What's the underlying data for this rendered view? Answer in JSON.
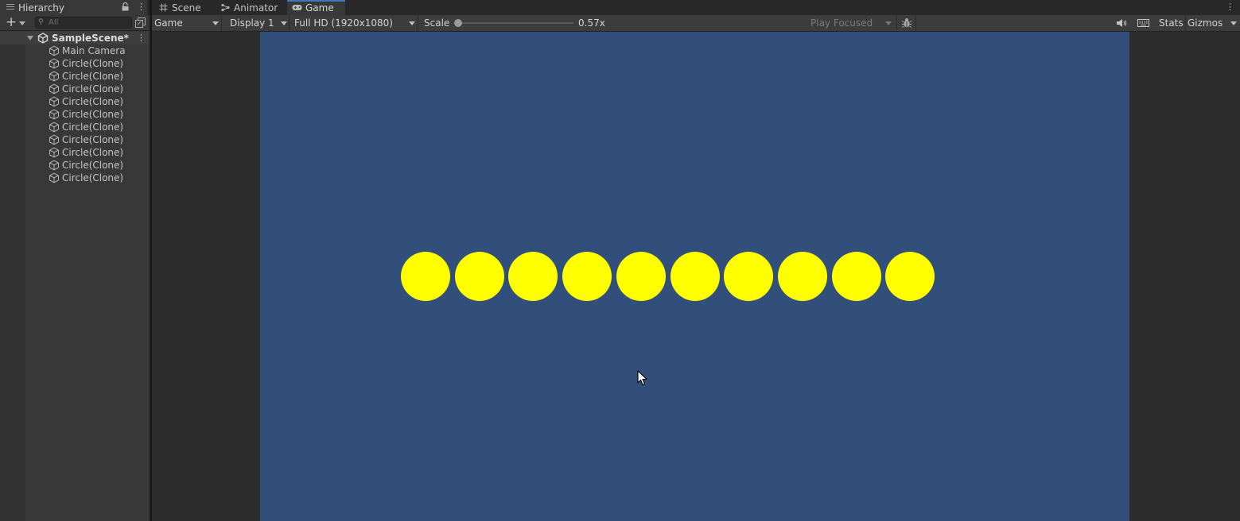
{
  "hierarchy": {
    "title": "Hierarchy",
    "search_placeholder": "All",
    "scene": {
      "name": "SampleScene*"
    },
    "objects": [
      "Main Camera",
      "Circle(Clone)",
      "Circle(Clone)",
      "Circle(Clone)",
      "Circle(Clone)",
      "Circle(Clone)",
      "Circle(Clone)",
      "Circle(Clone)",
      "Circle(Clone)",
      "Circle(Clone)",
      "Circle(Clone)"
    ]
  },
  "tabs": [
    {
      "label": "Scene",
      "icon": "grid-icon",
      "active": false
    },
    {
      "label": "Animator",
      "icon": "animator-icon",
      "active": false
    },
    {
      "label": "Game",
      "icon": "gamepad-icon",
      "active": true
    }
  ],
  "toolbar": {
    "view_mode": "Game",
    "display": "Display 1",
    "resolution": "Full HD (1920x1080)",
    "scale_label": "Scale",
    "scale_value": "0.57x",
    "scale_fraction": 0.0,
    "play_mode": "Play Focused",
    "stats_label": "Stats",
    "gizmos_label": "Gizmos"
  },
  "game_view": {
    "background_color": "#314f7a",
    "circle_color": "#ffff00",
    "circle_count": 10
  },
  "colors": {
    "accent": "#3a79bb"
  }
}
